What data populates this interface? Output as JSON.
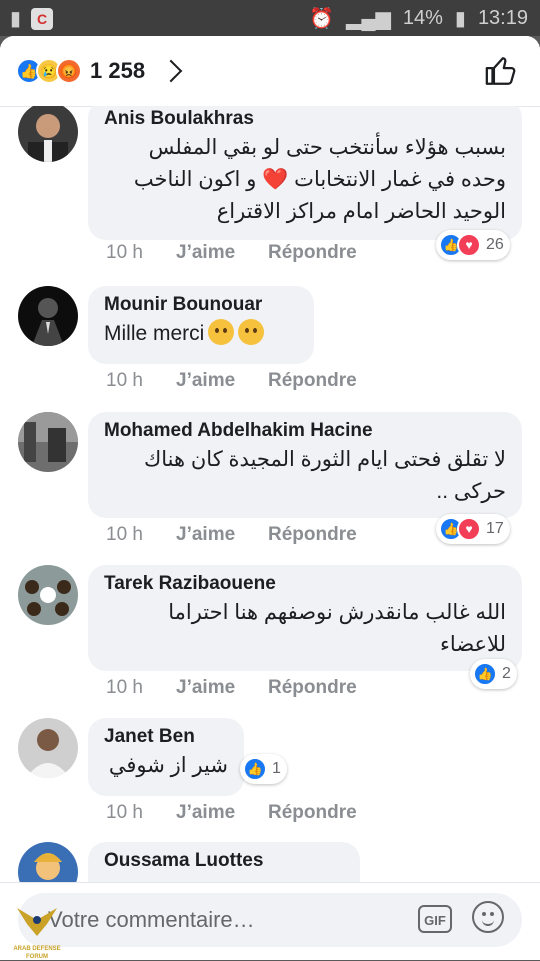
{
  "status_bar": {
    "battery": "14%",
    "time": "13:19"
  },
  "header": {
    "reaction_count": "1 258",
    "reaction_icons": [
      "like-icon",
      "sad-icon",
      "angry-icon"
    ]
  },
  "comments": [
    {
      "name": "Anis Boulakhras",
      "lines": [
        "بسبب هؤلاء سأنتخب حتى لو بقي المفلس",
        "وحده في غمار الانتخابات ❤️ و اكون الناخب",
        "الوحيد الحاضر امام مراكز الاقتراع"
      ],
      "time": "10 h",
      "like": "J’aime",
      "reply": "Répondre",
      "reaction_count": "26"
    },
    {
      "name": "Mounir Bounouar",
      "lines": [
        "Mille merci"
      ],
      "time": "10 h",
      "like": "J’aime",
      "reply": "Répondre",
      "reaction_count": ""
    },
    {
      "name": "Mohamed Abdelhakim Hacine",
      "lines": [
        "لا تقلق فحتى ايام الثورة المجيدة كان هناك",
        "حركى .."
      ],
      "time": "10 h",
      "like": "J’aime",
      "reply": "Répondre",
      "reaction_count": "17"
    },
    {
      "name": "Tarek Razibaouene",
      "lines": [
        "الله غالب مانقدرش نوصفهم هنا احتراما",
        "للاعضاء"
      ],
      "time": "10 h",
      "like": "J’aime",
      "reply": "Répondre",
      "reaction_count": "2"
    },
    {
      "name": "Janet Ben",
      "lines": [
        "شير از شوفي"
      ],
      "time": "10 h",
      "like": "J’aime",
      "reply": "Répondre",
      "reaction_count": "1"
    },
    {
      "name": "Oussama Luottes",
      "lines": []
    }
  ],
  "composer": {
    "placeholder": "Votre commentaire…",
    "gif_label": "GIF"
  },
  "watermark": {
    "text": "ARAB DEFENSE FORUM"
  },
  "colors": {
    "accent": "#1877f2",
    "love": "#f33e58",
    "bubble": "#f0f2f5",
    "meta": "#8a8d91"
  }
}
